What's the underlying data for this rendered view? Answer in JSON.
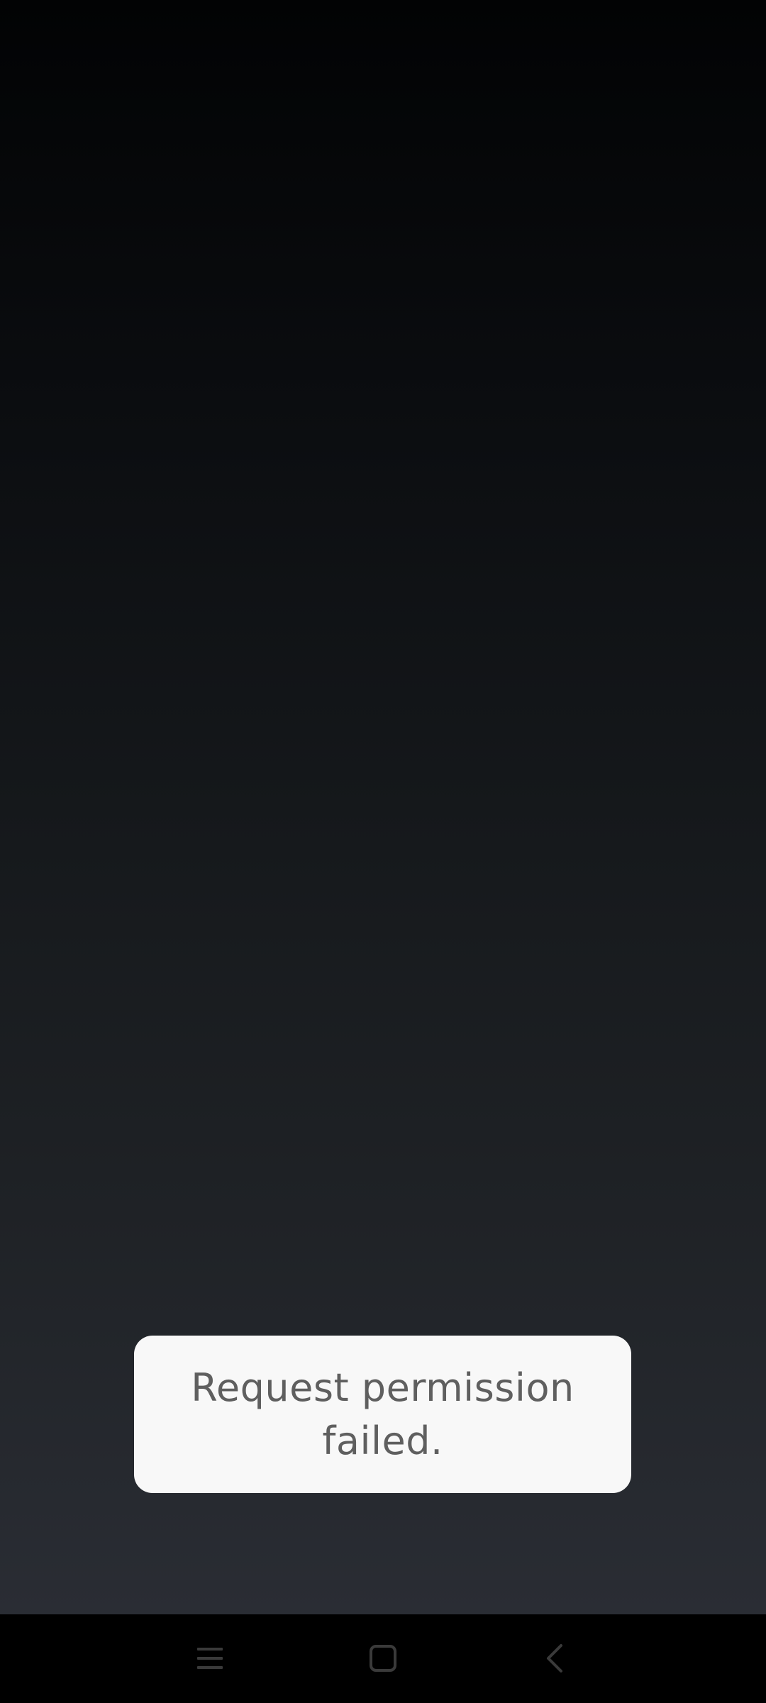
{
  "toast": {
    "message": "Request permission failed."
  },
  "navigation_bar": {
    "buttons": [
      {
        "name": "menu",
        "icon": "menu-icon"
      },
      {
        "name": "home",
        "icon": "home-square-icon"
      },
      {
        "name": "back",
        "icon": "back-chevron-icon"
      }
    ]
  },
  "colors": {
    "background_top": "#020304",
    "background_bottom": "#2a2d34",
    "toast_background": "#f8f8f8",
    "toast_text": "#5f5f5f",
    "nav_bar": "#000000",
    "nav_icon": "#3a3a3a"
  }
}
